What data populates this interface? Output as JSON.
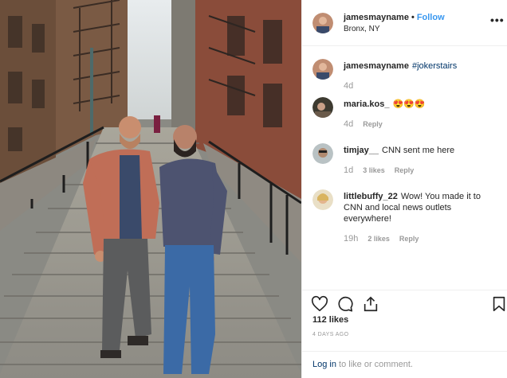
{
  "post": {
    "author": "jamesmayname",
    "follow_label": "Follow",
    "separator": "•",
    "location": "Bronx, NY",
    "more_label": "•••"
  },
  "comments": [
    {
      "user": "jamesmayname",
      "text": "",
      "tag": "#jokerstairs",
      "age": "4d",
      "likes": "",
      "reply": ""
    },
    {
      "user": "maria.kos_",
      "text": "😍😍😍",
      "tag": "",
      "age": "4d",
      "likes": "",
      "reply": "Reply"
    },
    {
      "user": "timjay__",
      "text": "CNN sent me here",
      "tag": "",
      "age": "1d",
      "likes": "3 likes",
      "reply": "Reply"
    },
    {
      "user": "littlebuffy_22",
      "text": "Wow! You made it to CNN and local news outlets everywhere!",
      "tag": "",
      "age": "19h",
      "likes": "2 likes",
      "reply": "Reply"
    }
  ],
  "actions": {
    "like_icon": "heart-icon",
    "comment_icon": "comment-icon",
    "share_icon": "share-icon",
    "save_icon": "bookmark-icon",
    "likes_text": "112 likes",
    "timestamp": "4 DAYS AGO",
    "login_link": "Log in",
    "login_rest": " to like or comment."
  },
  "colors": {
    "link_blue": "#3897f0",
    "tag_blue": "#003569",
    "meta_gray": "#999999",
    "border": "#efefef"
  }
}
